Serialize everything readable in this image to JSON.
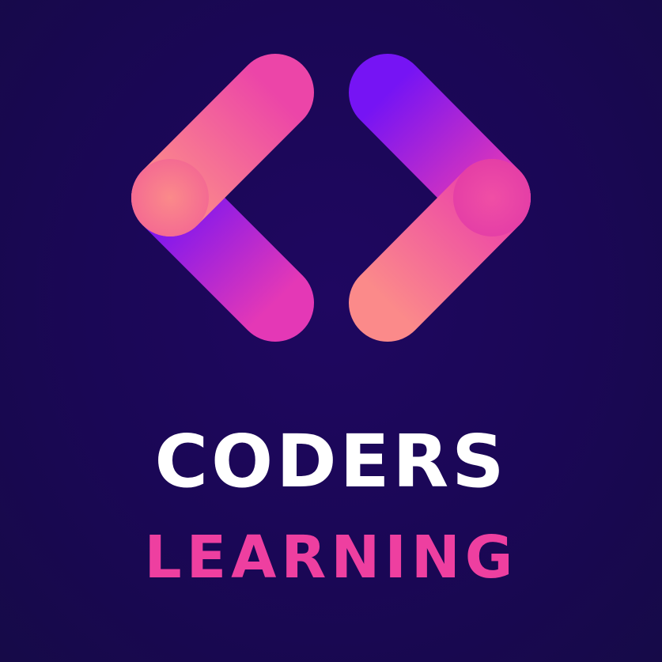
{
  "brand": {
    "name_line1": "CODERS",
    "name_line2": "LEARNING",
    "logo_icon": "code-brackets-icon"
  },
  "colors": {
    "background": "#1a0755",
    "line1_text": "#ffffff",
    "line2_text": "#ee3fa0",
    "pink": "#f0528f",
    "coral": "#fb8a8a",
    "magenta": "#e438b6",
    "violet": "#7614f4"
  }
}
